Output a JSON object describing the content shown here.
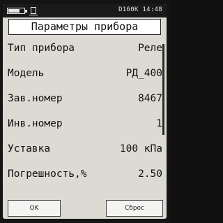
{
  "status": {
    "battery_icon": "battery-icon",
    "sd_icon": "sd-card-icon",
    "device_time": "D160K 14:48"
  },
  "title": "Параметры прибора",
  "params": [
    {
      "label": "Тип прибора",
      "value": "Реле"
    },
    {
      "label": "Модель",
      "value": "РД_400"
    },
    {
      "label": "Зав.номер",
      "value": "8467"
    },
    {
      "label": "Инв.номер",
      "value": "1"
    },
    {
      "label": "Уставка",
      "value": "100 кПа"
    },
    {
      "label": "Погрешность,%",
      "value": "2.50"
    }
  ],
  "buttons": {
    "ok": "OK",
    "reset": "Сброс"
  }
}
